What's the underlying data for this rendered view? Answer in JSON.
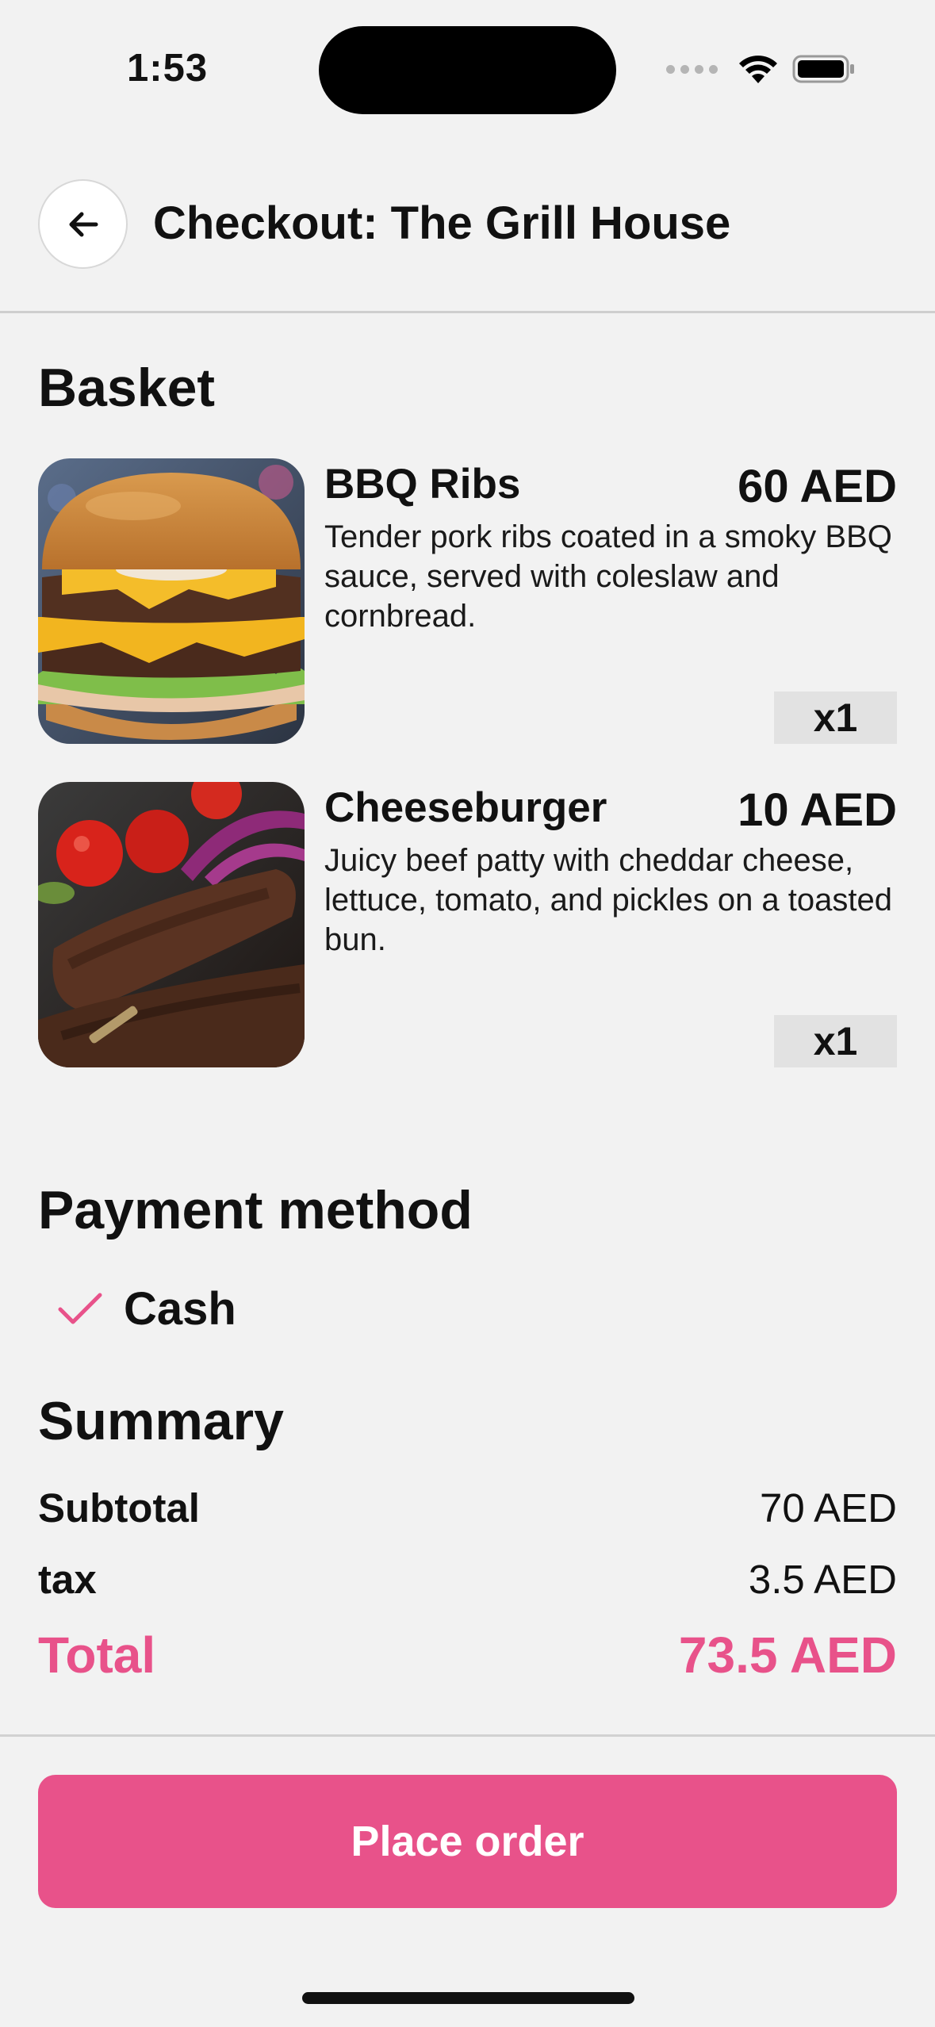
{
  "status_bar": {
    "time": "1:53"
  },
  "header": {
    "title": "Checkout: The Grill House",
    "back_icon": "arrow-left-icon"
  },
  "basket": {
    "title": "Basket",
    "items": [
      {
        "name": "BBQ Ribs",
        "price": "60 AED",
        "description": "Tender pork ribs coated in a smoky BBQ sauce, served with coleslaw and cornbread.",
        "quantity": "x1",
        "image_icon": "burger-photo"
      },
      {
        "name": "Cheeseburger",
        "price": "10 AED",
        "description": "Juicy beef patty with cheddar cheese, lettuce, tomato, and pickles on a toasted bun.",
        "quantity": "x1",
        "image_icon": "kebab-photo"
      }
    ]
  },
  "payment": {
    "title": "Payment method",
    "selected": "Cash",
    "check_icon": "checkmark-icon"
  },
  "summary": {
    "title": "Summary",
    "subtotal_label": "Subtotal",
    "subtotal_value": "70 AED",
    "tax_label": "tax",
    "tax_value": "3.5 AED",
    "total_label": "Total",
    "total_value": "73.5 AED"
  },
  "footer": {
    "place_order_label": "Place order"
  },
  "colors": {
    "accent": "#e8528a",
    "background": "#f2f2f2",
    "quantity_badge": "#e2e2e2"
  }
}
